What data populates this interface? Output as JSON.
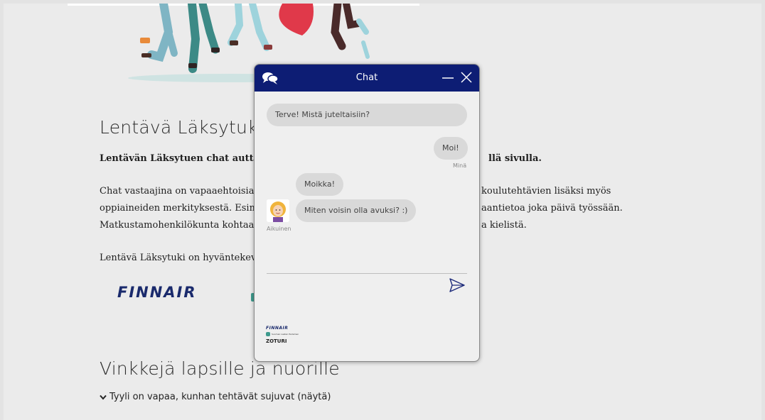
{
  "page": {
    "heading": "Lentävä Läksytuki",
    "intro_bold": "Lentävän Läksytuen chat auttaa s",
    "intro_bold_tail": "llä sivulla.",
    "para_lines": [
      {
        "left": "Chat vastaajina on vapaaehtoisia F",
        "right": "koulutehtävien lisäksi myös"
      },
      {
        "left": "oppiaineiden merkityksestä. Esim",
        "right": "aantietoa joka päivä työssään."
      },
      {
        "left": "Matkustamohenkilökunta kohtaa t",
        "right": "a kielistä."
      }
    ],
    "charity_line": "Lentävä Läksytuki on hyväntekev",
    "logo_text": "FINNAIR",
    "tips_heading": "Vinkkejä lapsille ja nuorille",
    "toggle_text": "Tyyli on vapaa, kunhan tehtävät sujuvat (näytä)"
  },
  "chat": {
    "title": "Chat",
    "messages": [
      {
        "from": "bot",
        "text": "Terve! Mistä juteltaisiin?"
      },
      {
        "from": "user",
        "text": "Moi!",
        "sender": "Minä"
      },
      {
        "from": "agent",
        "text": "Moikka!"
      },
      {
        "from": "agent",
        "text": "Miten voisin olla avuksi? :)",
        "sender": "Aikuinen"
      }
    ],
    "input_placeholder": "",
    "footer_logo_1": "FINNAIR",
    "footer_logo_2": "Suomen Lasten Parlamentti",
    "footer_logo_3": "ZOTURI"
  },
  "colors": {
    "chat_header": "#0d1d74",
    "bubble": "#d9d9d9",
    "finnair_blue": "#1a2a6c"
  }
}
